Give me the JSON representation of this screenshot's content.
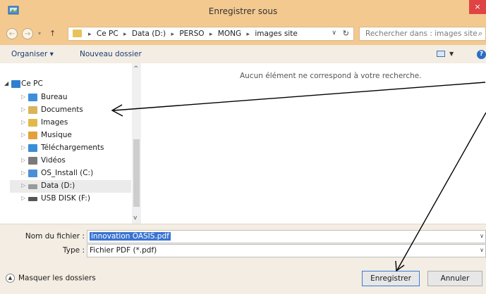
{
  "window": {
    "title": "Enregistrer sous",
    "close_glyph": "×"
  },
  "address_bar": {
    "back_glyph": "←",
    "forward_glyph": "→",
    "recent_glyph": "▾",
    "up_glyph": "↑",
    "breadcrumbs": [
      "Ce PC",
      "Data (D:)",
      "PERSO",
      "MONG",
      "images site"
    ],
    "separator": "▸",
    "dropdown_glyph": "∨",
    "refresh_glyph": "↻"
  },
  "search": {
    "placeholder": "Rechercher dans : images site",
    "icon": "⌕"
  },
  "toolbar": {
    "organize_label": "Organiser ▾",
    "new_folder_label": "Nouveau dossier",
    "view_dropdown_glyph": "▼",
    "help_glyph": "?"
  },
  "nav_tree": {
    "root_toggle": "◢",
    "item_toggle": "▷",
    "scroll_up": "^",
    "scroll_down": "v",
    "root": {
      "label": "Ce PC",
      "icon": "computer-icon",
      "color": "#2f7fd0"
    },
    "items": [
      {
        "label": "Bureau",
        "icon": "desktop-folder-icon",
        "color": "#3d8fd9"
      },
      {
        "label": "Documents",
        "icon": "documents-folder-icon",
        "color": "#d9b45a"
      },
      {
        "label": "Images",
        "icon": "images-folder-icon",
        "color": "#e0b94a"
      },
      {
        "label": "Musique",
        "icon": "music-folder-icon",
        "color": "#e2a13a"
      },
      {
        "label": "Téléchargements",
        "icon": "downloads-folder-icon",
        "color": "#3a8ed8"
      },
      {
        "label": "Vidéos",
        "icon": "videos-folder-icon",
        "color": "#7a7a7a"
      },
      {
        "label": "OS_Install (C:)",
        "icon": "system-drive-icon",
        "color": "#4a90d9"
      },
      {
        "label": "Data (D:)",
        "icon": "drive-icon",
        "color": "#9a9a9a"
      },
      {
        "label": "USB DISK (F:)",
        "icon": "usb-drive-icon",
        "color": "#555555"
      }
    ]
  },
  "content": {
    "empty_message": "Aucun élément ne correspond à votre recherche."
  },
  "form": {
    "filename_label": "Nom du fichier :",
    "filename_value": "innovation OASIS.pdf",
    "type_label": "Type :",
    "type_value": "Fichier PDF (*.pdf)",
    "dropdown_glyph": "∨"
  },
  "footer": {
    "hide_folders_label": "Masquer les dossiers",
    "hide_folders_glyph": "▲",
    "save_label": "Enregistrer",
    "cancel_label": "Annuler"
  },
  "colors": {
    "title_bar": "#f3c98f",
    "toolbar": "#f3ede3",
    "selection": "#3a73d1",
    "close": "#e04343"
  }
}
